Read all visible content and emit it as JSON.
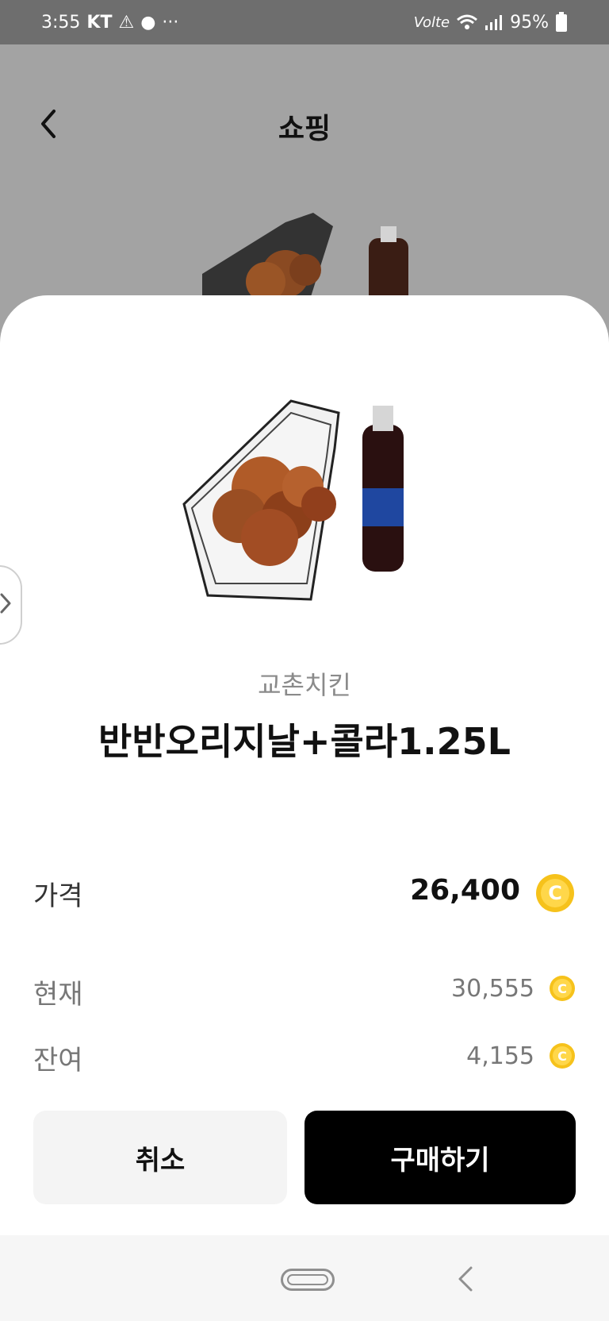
{
  "status_bar": {
    "time": "3:55",
    "carrier": "KT",
    "overflow": "···",
    "network": "Volte",
    "battery": "95%"
  },
  "header": {
    "title": "쇼핑",
    "back_icon": "chevron-left-icon"
  },
  "product": {
    "brand": "교촌치킨",
    "name": "반반오리지날+콜라1.25L"
  },
  "summary": {
    "price_label": "가격",
    "price_value": "26,400",
    "current_label": "현재",
    "current_value": "30,555",
    "remaining_label": "잔여",
    "remaining_value": "4,155",
    "coin_icon": "coin-icon",
    "coin_color": "#f6c21b"
  },
  "buttons": {
    "cancel": "취소",
    "buy": "구매하기"
  },
  "colors": {
    "buy_bg": "#000000",
    "cancel_bg": "#f4f4f4",
    "dim_overlay": "#a3a3a3"
  }
}
